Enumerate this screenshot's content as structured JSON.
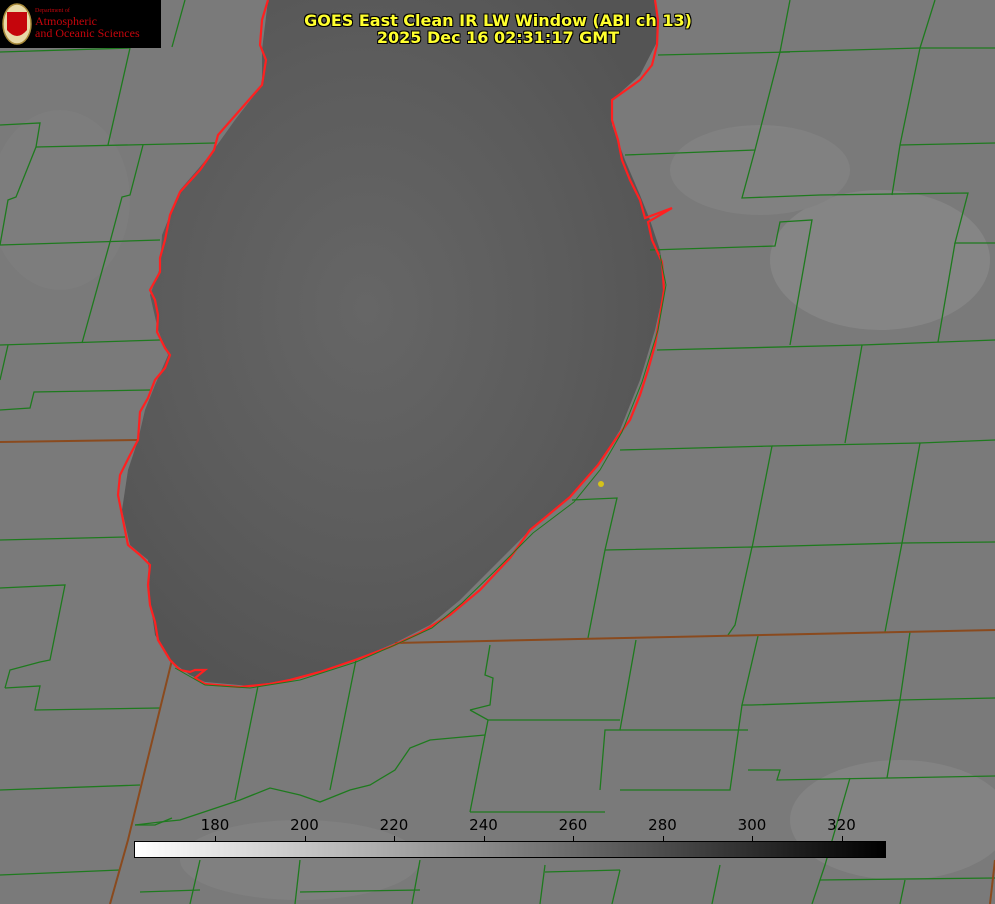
{
  "title": {
    "line1": "GOES East Clean IR LW Window (ABI ch 13)",
    "line2": "2025 Dec 16 02:31:17 GMT"
  },
  "logo": {
    "dept": "Department of",
    "line1": "Atmospheric",
    "line2": "and Oceanic Sciences",
    "seal_letter": "W"
  },
  "colorbar": {
    "ticks": [
      "180",
      "200",
      "220",
      "240",
      "260",
      "280",
      "300",
      "320"
    ],
    "gradient_from": "#ffffff",
    "gradient_to": "#000000"
  },
  "colors": {
    "county_lines": "#1e7a1e",
    "coastline": "#ff2020",
    "state_lines": "#8a4a1e",
    "lake": "#595959",
    "land": "#7a7a7a",
    "marker": "#d4c21a"
  }
}
